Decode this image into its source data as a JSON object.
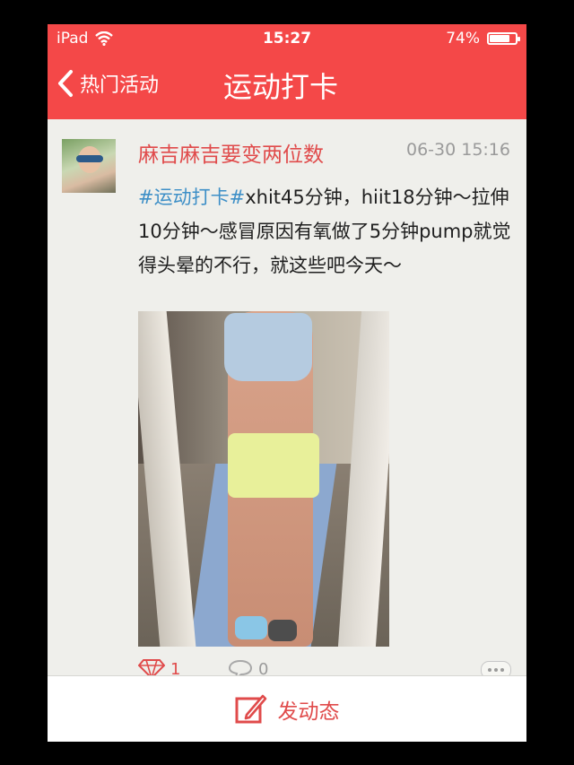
{
  "status_bar": {
    "device": "iPad",
    "time": "15:27",
    "battery": "74%",
    "battery_level": 0.74
  },
  "nav": {
    "back_label": "热门活动",
    "title": "运动打卡"
  },
  "post": {
    "username": "麻吉麻吉要变两位数",
    "timestamp": "06-30 15:16",
    "hashtag": "#运动打卡#",
    "text": "xhit45分钟，hiit18分钟～拉伸10分钟～感冒原因有氧做了5分钟pump就觉得头晕的不行，就这些吧今天～",
    "likes": "1",
    "comments": "0"
  },
  "bottom": {
    "post_label": "发动态"
  },
  "colors": {
    "accent": "#f44848",
    "hashtag": "#3d8fc7",
    "username": "#e04b4b"
  },
  "icons": {
    "back": "chevron-left-icon",
    "wifi": "wifi-icon",
    "battery": "battery-icon",
    "like": "diamond-icon",
    "comment": "comment-bubble-icon",
    "more": "more-dots-icon",
    "compose": "compose-icon"
  }
}
